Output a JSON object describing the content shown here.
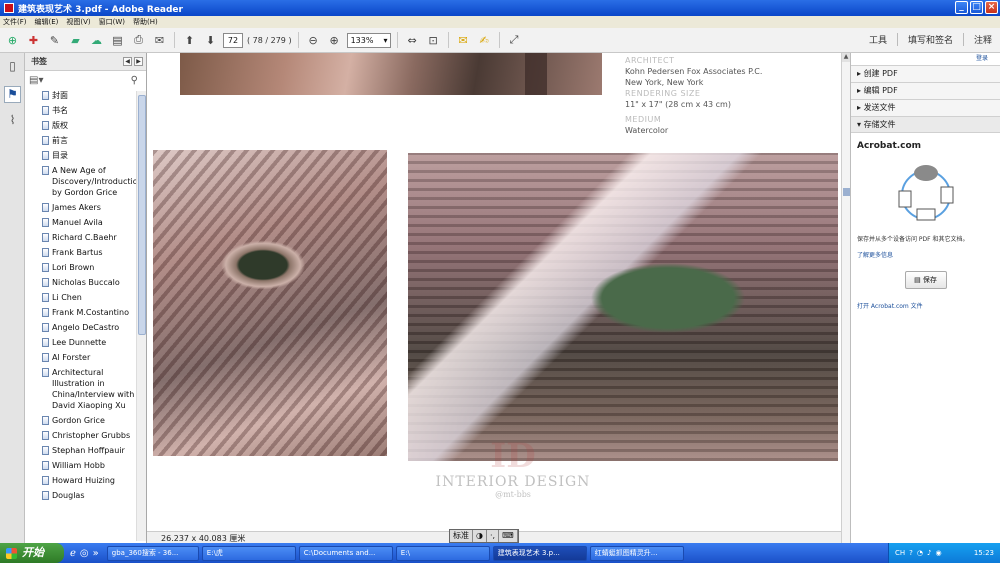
{
  "window": {
    "title": "建筑表现艺术 3.pdf - Adobe Reader",
    "buttons": [
      "_",
      "□",
      "×"
    ]
  },
  "menu": [
    "文件(F)",
    "编辑(E)",
    "视图(V)",
    "窗口(W)",
    "帮助(H)"
  ],
  "toolbar": {
    "page_number": "72",
    "page_count": "( 78 / 279 )",
    "zoom": "133%",
    "right_links": [
      "工具",
      "填写和签名",
      "注释"
    ]
  },
  "bookmarks": {
    "header": "书签",
    "items": [
      "封面",
      "书名",
      "版权",
      "前言",
      "目录",
      "A New Age of Discovery/Introduction by Gordon Grice",
      "James Akers",
      "Manuel Avila",
      "Richard C.Baehr",
      "Frank Bartus",
      "Lori Brown",
      "Nicholas Buccalo",
      "Li Chen",
      "Frank M.Costantino",
      "Angelo DeCastro",
      "Lee Dunnette",
      "Al Forster",
      "Architectural Illustration in China/Interview with David Xiaoping Xu",
      "Gordon Grice",
      "Christopher Grubbs",
      "Stephan Hoffpauir",
      "William Hobb",
      "Howard Huizing",
      "Douglas"
    ]
  },
  "document": {
    "caption": {
      "architect_label": "ARCHITECT",
      "architect": "Kohn Pedersen Fox Associates P.C.",
      "city": "New York, New York",
      "rendering_label": "RENDERING SIZE",
      "rendering_size": "11\" x 17\" (28 cm x 43 cm)",
      "medium_label": "MEDIUM",
      "medium": "Watercolor"
    },
    "watermark": {
      "title": "INTERIOR DESIGN",
      "sub": "@mt-bbs"
    },
    "page_size": "26.237 x 40.083 厘米",
    "ime_bar": [
      "标准",
      "◑",
      "·,",
      "⌨"
    ]
  },
  "right_panel": {
    "login": "登录",
    "sections": [
      "创建 PDF",
      "编辑 PDF",
      "发送文件",
      "存储文件"
    ],
    "brand": "Acrobat.com",
    "description": "保存并从多个设备访问 PDF 和其它文档。",
    "learn_more": "了解更多信息",
    "save_button": "保存",
    "open_link": "打开 Acrobat.com 文件"
  },
  "taskbar": {
    "start": "开始",
    "tasks": [
      "gba_360搜索 - 36...",
      "E:\\虎",
      "C:\\Documents and...",
      "E:\\",
      "建筑表现艺术 3.p...",
      "红蜻蜓抓图精灵升..."
    ],
    "tray_lang": "CH",
    "clock": "15:23"
  },
  "colors": {
    "title_blue": "#0a46c8",
    "taskbar_blue": "#1a50c8",
    "start_green": "#3a8a32",
    "link_blue": "#1a4e9a"
  }
}
